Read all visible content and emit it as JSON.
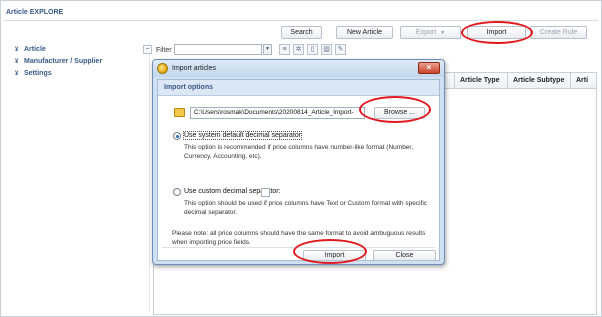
{
  "app": {
    "title": "Article EXPLORE"
  },
  "toolbar": {
    "search_label": "Search",
    "new_article_label": "New Article",
    "export_label": "Export",
    "import_label": "Import",
    "create_rule_label": "Create Rule"
  },
  "sidebar": {
    "items": [
      {
        "label": "Article"
      },
      {
        "label": "Manufacturer / Supplier"
      },
      {
        "label": "Settings"
      }
    ]
  },
  "filter": {
    "label": "Filter",
    "value": ""
  },
  "grid": {
    "columns": [
      "Article Type",
      "Article Subtype",
      "Arti"
    ]
  },
  "dialog": {
    "title": "Import articles",
    "section_label": "Import options",
    "file_path": "C:\\Users\\rosmak\\Documents\\20200814_Article_Import-",
    "browse_label": "Browse ...",
    "option_system": {
      "label": "Use system default decimal separator",
      "description": "This option is recommended if price columns have number-like format (Number, Currency, Accounting, etc).",
      "checked": true
    },
    "option_custom": {
      "label": "Use custom decimal separator:",
      "description": "This option should be used if price columns have Text or Custom format with specific decimal separator.",
      "separator_value": "",
      "checked": false
    },
    "note": "Please note: all price columns should have the same format to avoid ambuguous results when importing price fields.",
    "import_label": "Import",
    "close_label": "Close"
  },
  "colors": {
    "highlight_oval": "#e0191f",
    "accent_text": "#3a5a86",
    "dialog_frame": "#cfe0f2"
  }
}
